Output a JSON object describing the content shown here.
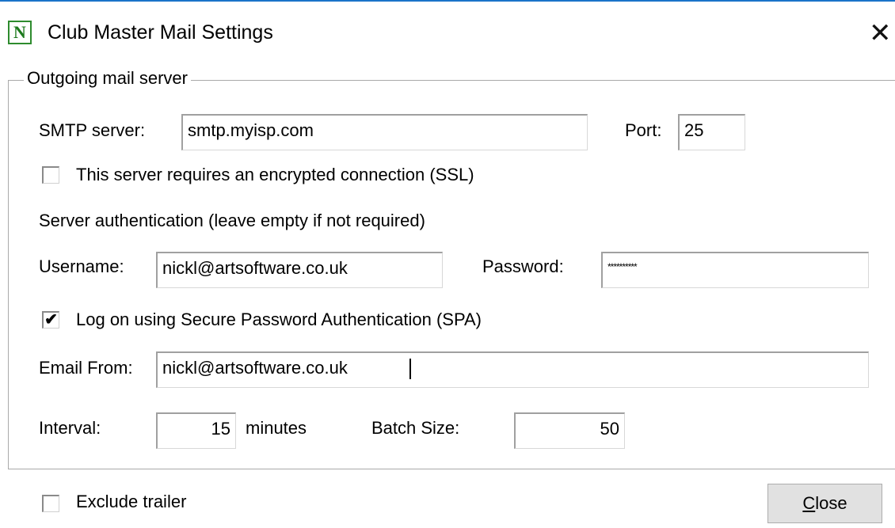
{
  "window": {
    "title": "Club Master Mail Settings",
    "app_icon_letter": "N"
  },
  "group": {
    "legend": "Outgoing mail server"
  },
  "smtp": {
    "label": "SMTP server:",
    "value": "smtp.myisp.com",
    "port_label": "Port:",
    "port_value": "25"
  },
  "ssl": {
    "label": "This server requires an encrypted connection (SSL)",
    "checked": false
  },
  "auth": {
    "heading": "Server authentication (leave empty if not required)",
    "username_label": "Username:",
    "username_value": "nickl@artsoftware.co.uk",
    "password_label": "Password:",
    "password_value": "**********"
  },
  "spa": {
    "label": "Log on using Secure Password Authentication (SPA)",
    "checked": true,
    "check_glyph": "✔"
  },
  "email_from": {
    "label": "Email From:",
    "value": "nickl@artsoftware.co.uk"
  },
  "interval": {
    "label": "Interval:",
    "value": "15",
    "unit": "minutes"
  },
  "batch": {
    "label": "Batch Size:",
    "value": "50"
  },
  "exclude_trailer": {
    "label": "Exclude trailer",
    "checked": false
  },
  "buttons": {
    "close_mnemonic": "C",
    "close_rest": "lose"
  }
}
